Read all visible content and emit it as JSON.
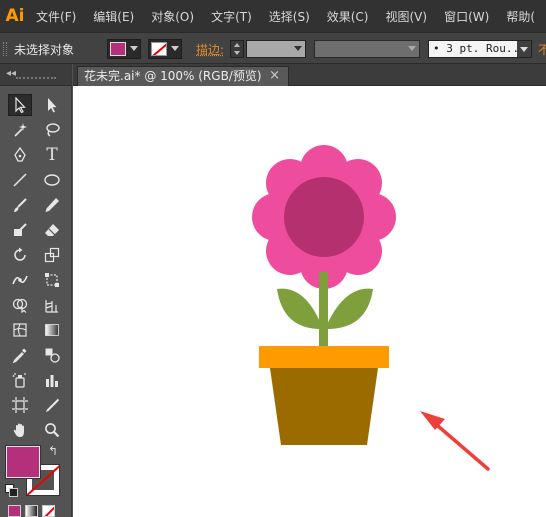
{
  "app": {
    "logo": "Ai"
  },
  "menu": {
    "items": [
      "文件(F)",
      "编辑(E)",
      "对象(O)",
      "文字(T)",
      "选择(S)",
      "效果(C)",
      "视图(V)",
      "窗口(W)",
      "帮助("
    ]
  },
  "control_bar": {
    "selection_label": "未选择对象",
    "fill_color": "#b5307a",
    "stroke_label": "描边:",
    "brush_definition": "• 3 pt. Rou..",
    "opacity_label": "不"
  },
  "document": {
    "tab_title": "花未完.ai* @ 100% (RGB/预览)",
    "close_glyph": "×"
  },
  "tools": {
    "type_glyph": "T"
  },
  "artwork": {
    "petal_color": "#ee4c9c",
    "center_color": "#b5306e",
    "stem_color": "#7e9f3c",
    "pot_rim_color": "#ff9a00",
    "pot_body_color": "#9c6b00",
    "arrow_color": "#ef3f3a"
  },
  "colors": {
    "accent_orange": "#ff9a00",
    "panel_bg": "#535353",
    "menubar_bg": "#323232"
  }
}
